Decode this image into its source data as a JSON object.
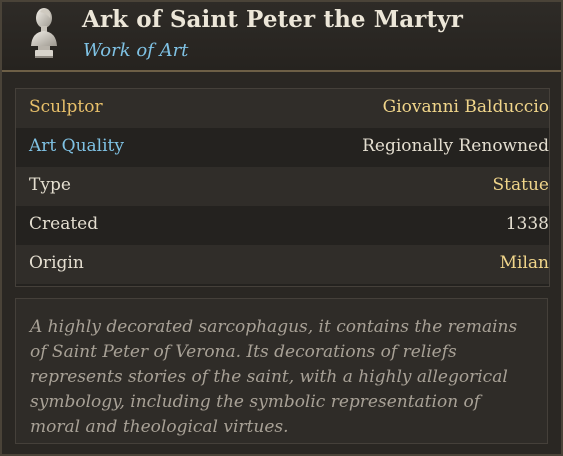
{
  "header": {
    "title": "Ark of Saint Peter the Martyr",
    "subtitle": "Work of Art",
    "icon": "marble-bust-icon"
  },
  "details": {
    "rows": [
      {
        "label": "Sculptor",
        "value": "Giovanni Balduccio",
        "label_color": "#e8c06a",
        "value_color": "#f0d58a"
      },
      {
        "label": "Art Quality",
        "value": "Regionally Renowned",
        "label_color": "#7fc2e4",
        "value_color": "#e4ded0"
      },
      {
        "label": "Type",
        "value": "Statue",
        "label_color": "#e4ded0",
        "value_color": "#f0d58a"
      },
      {
        "label": "Created",
        "value": "1338",
        "label_color": "#e4ded0",
        "value_color": "#e4ded0"
      },
      {
        "label": "Origin",
        "value": "Milan",
        "label_color": "#e4ded0",
        "value_color": "#f0d58a"
      }
    ]
  },
  "description": "A highly decorated sarcophagus, it contains the remains of Saint Peter of Verona. Its decorations of reliefs represents stories of the saint, with a highly allegorical symbology, including the symbolic representation of moral and theological virtues.",
  "colors": {
    "accent_gold": "#e8c06a",
    "accent_blue": "#7fc2e4",
    "panel_bg": "#2a2723",
    "border": "#6d5f46"
  }
}
